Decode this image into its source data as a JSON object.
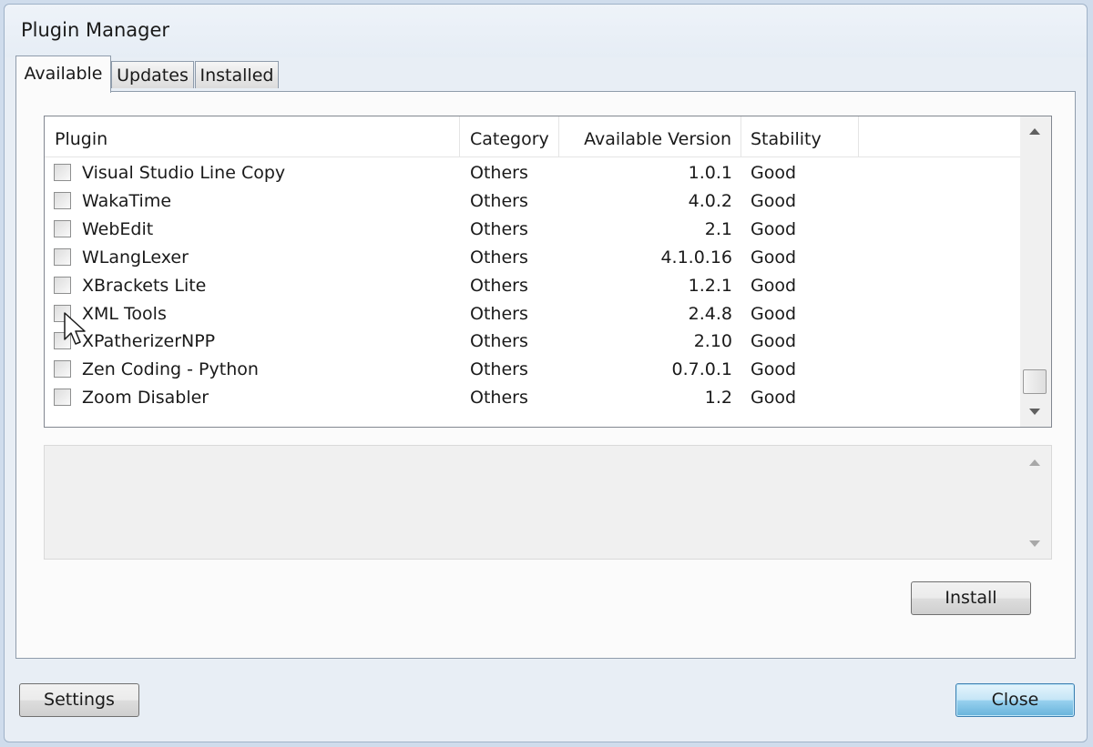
{
  "window": {
    "title": "Plugin Manager"
  },
  "tabs": [
    {
      "label": "Available",
      "active": true
    },
    {
      "label": "Updates",
      "active": false
    },
    {
      "label": "Installed",
      "active": false
    }
  ],
  "table": {
    "columns": [
      "Plugin",
      "Category",
      "Available Version",
      "Stability"
    ],
    "rows": [
      {
        "plugin": "Visual Studio Line Copy",
        "category": "Others",
        "version": "1.0.1",
        "stability": "Good",
        "checked": false
      },
      {
        "plugin": "WakaTime",
        "category": "Others",
        "version": "4.0.2",
        "stability": "Good",
        "checked": false
      },
      {
        "plugin": "WebEdit",
        "category": "Others",
        "version": "2.1",
        "stability": "Good",
        "checked": false
      },
      {
        "plugin": "WLangLexer",
        "category": "Others",
        "version": "4.1.0.16",
        "stability": "Good",
        "checked": false
      },
      {
        "plugin": "XBrackets Lite",
        "category": "Others",
        "version": "1.2.1",
        "stability": "Good",
        "checked": false
      },
      {
        "plugin": "XML Tools",
        "category": "Others",
        "version": "2.4.8",
        "stability": "Good",
        "checked": false
      },
      {
        "plugin": "XPatherizerNPP",
        "category": "Others",
        "version": "2.10",
        "stability": "Good",
        "checked": false
      },
      {
        "plugin": "Zen Coding - Python",
        "category": "Others",
        "version": "0.7.0.1",
        "stability": "Good",
        "checked": false
      },
      {
        "plugin": "Zoom Disabler",
        "category": "Others",
        "version": "1.2",
        "stability": "Good",
        "checked": false
      }
    ]
  },
  "buttons": {
    "install": "Install",
    "settings": "Settings",
    "close": "Close"
  },
  "icons": {
    "scroll_up": "scroll-up-arrow-icon",
    "scroll_down": "scroll-down-arrow-icon",
    "cursor": "mouse-pointer-icon"
  }
}
